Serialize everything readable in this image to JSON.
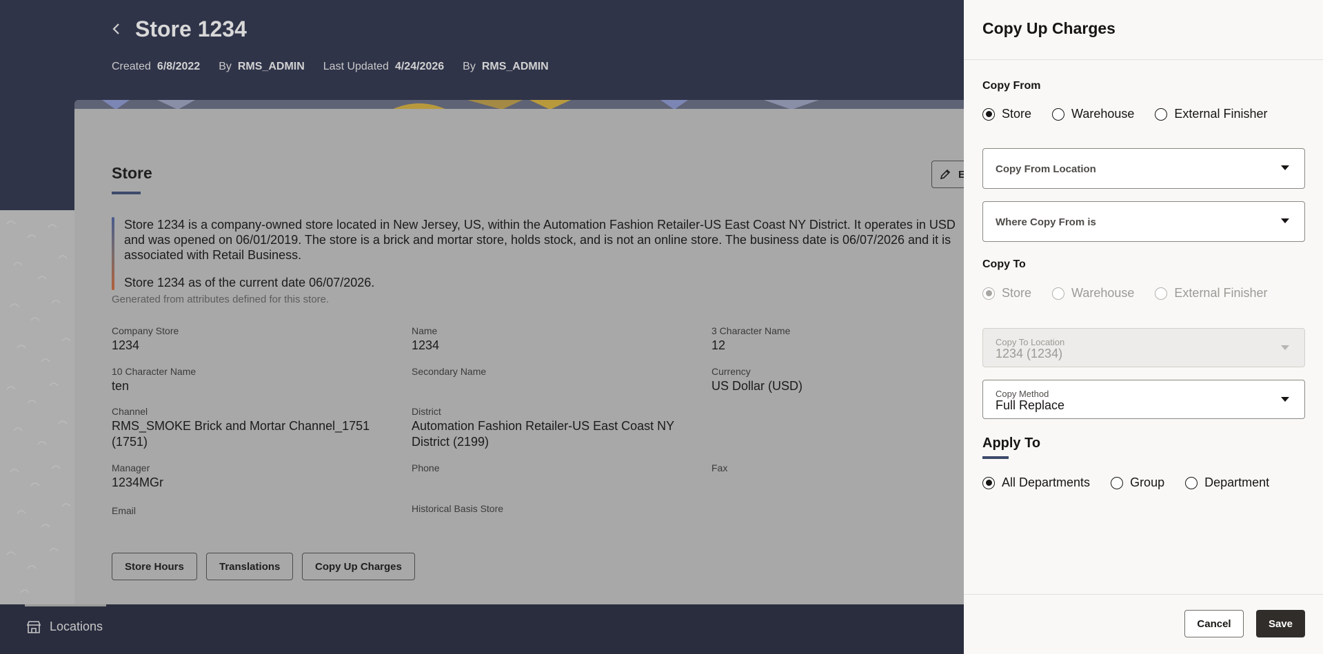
{
  "page": {
    "title": "Store 1234",
    "meta": {
      "created_label": "Created",
      "created_value": "6/8/2022",
      "by1_label": "By",
      "by1_value": "RMS_ADMIN",
      "updated_label": "Last Updated",
      "updated_value": "4/24/2026",
      "by2_label": "By",
      "by2_value": "RMS_ADMIN"
    }
  },
  "card": {
    "title": "Store",
    "edit_label": "E",
    "summary": [
      "Store 1234 is a company-owned store located in New Jersey, US, within the Automation Fashion Retailer-US East Coast NY District. It operates in USD and was opened on 06/01/2019. The store is a brick and mortar store, holds stock, and is not an online store. The business date is 06/07/2026 and it is associated with Retail Business.",
      "Store 1234 as of the current date 06/07/2026."
    ],
    "generated_note": "Generated from attributes defined for this store.",
    "fields": [
      {
        "label": "Company Store",
        "value": "1234"
      },
      {
        "label": "Name",
        "value": "1234"
      },
      {
        "label": "3 Character Name",
        "value": "12"
      },
      {
        "label": "10 Character Name",
        "value": "ten"
      },
      {
        "label": "Secondary Name",
        "value": ""
      },
      {
        "label": "Currency",
        "value": "US Dollar (USD)"
      },
      {
        "label": "Channel",
        "value": "RMS_SMOKE Brick and Mortar Channel_1751 (1751)"
      },
      {
        "label": "District",
        "value": "Automation Fashion Retailer-US East Coast NY District (2199)"
      },
      {
        "label": "Manager",
        "value": "1234MGr"
      },
      {
        "label": "Phone",
        "value": ""
      },
      {
        "label": "Fax",
        "value": ""
      },
      {
        "label": "Email",
        "value": ""
      },
      {
        "label": "Historical Basis Store",
        "value": ""
      }
    ],
    "buttons": {
      "store_hours": "Store Hours",
      "translations": "Translations",
      "copy_up_charges": "Copy Up Charges"
    }
  },
  "footer": {
    "locations_label": "Locations"
  },
  "drawer": {
    "title": "Copy Up Charges",
    "copy_from": {
      "label": "Copy From",
      "options": [
        "Store",
        "Warehouse",
        "External Finisher"
      ],
      "selected": "Store"
    },
    "copy_from_location": {
      "placeholder": "Copy From Location"
    },
    "where_copy_from": {
      "placeholder": "Where Copy From is"
    },
    "copy_to": {
      "label": "Copy To",
      "options": [
        "Store",
        "Warehouse",
        "External Finisher"
      ],
      "selected": "Store",
      "disabled": true
    },
    "copy_to_location": {
      "label": "Copy To Location",
      "value": "1234 (1234)"
    },
    "copy_method": {
      "label": "Copy Method",
      "value": "Full Replace"
    },
    "apply_to": {
      "label": "Apply To",
      "options": [
        "All Departments",
        "Group",
        "Department"
      ],
      "selected": "All Departments"
    },
    "cancel_label": "Cancel",
    "save_label": "Save"
  },
  "colors": {
    "hero": "#303449",
    "overlay_card": "#a8a8a8",
    "drawer_bg": "#f9f8f6",
    "primary_button": "#312d2a",
    "accent_underline": "#3d4a6b"
  }
}
